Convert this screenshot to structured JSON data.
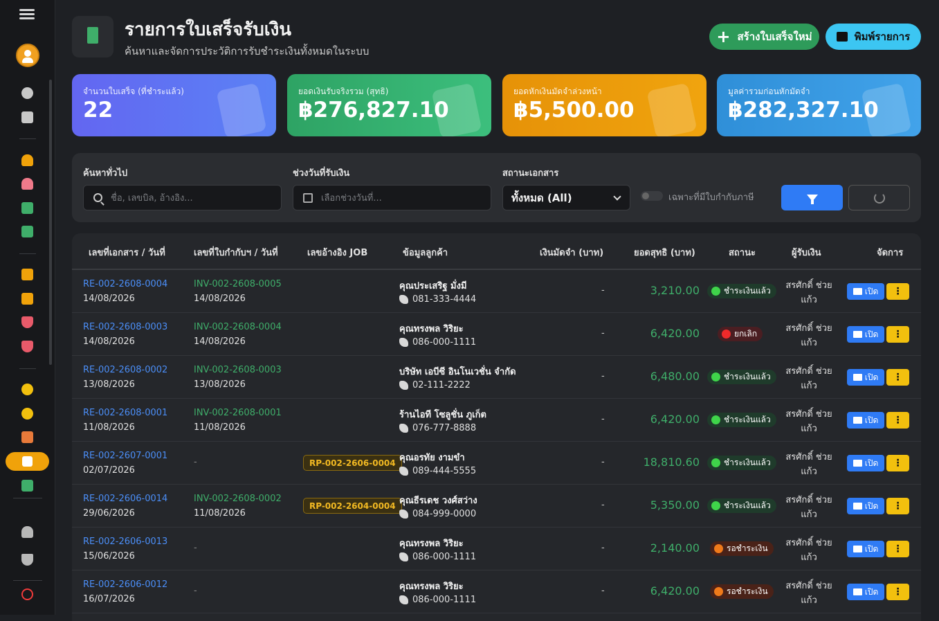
{
  "header": {
    "title": "รายการใบเสร็จรับเงิน",
    "subtitle": "ค้นหาและจัดการประวัติการรับชำระเงินทั้งหมดในระบบ",
    "new_button": "สร้างใบเสร็จใหม่",
    "print_button": "พิมพ์รายการ",
    "new_icon": "+"
  },
  "cards": [
    {
      "label": "จำนวนใบเสร็จ (ที่ชำระแล้ว)",
      "value": "22"
    },
    {
      "label": "ยอดเงินรับจริงรวม (สุทธิ)",
      "value": "฿276,827.10"
    },
    {
      "label": "ยอดหักเงินมัดจำล่วงหน้า",
      "value": "฿5,500.00"
    },
    {
      "label": "มูลค่ารวมก่อนหักมัดจำ",
      "value": "฿282,327.10"
    }
  ],
  "filters": {
    "search_label": "ค้นหาทั่วไป",
    "search_placeholder": "ชื่อ, เลขบิล, อ้างอิง...",
    "date_label": "ช่วงวันที่รับเงิน",
    "date_placeholder": "เลือกช่วงวันที่...",
    "status_label": "สถานะเอกสาร",
    "status_value": "ทั้งหมด (All)",
    "tax_toggle_label": "เฉพาะที่มีใบกำกับภาษี"
  },
  "table": {
    "headers": [
      "เลขที่เอกสาร / วันที่",
      "เลขที่ใบกำกับฯ / วันที่",
      "เลขอ้างอิง JOB",
      "ข้อมูลลูกค้า",
      "เงินมัดจำ (บาท)",
      "ยอดสุทธิ (บาท)",
      "สถานะ",
      "ผู้รับเงิน",
      "จัดการ"
    ],
    "open_label": "เปิด",
    "more_label": "⋮",
    "rows": [
      {
        "doc": "RE-002-2608-0004",
        "date": "14/08/2026",
        "inv": "INV-002-2608-0005",
        "inv_date": "14/08/2026",
        "job": "",
        "customer": "คุณประเสริฐ มั่งมี",
        "phone": "081-333-4444",
        "deposit": "-",
        "net": "3,210.00",
        "status": "ชำระเงินแล้ว",
        "status_type": "paid",
        "receiver": "สรศักดิ์ ช่วยแก้ว"
      },
      {
        "doc": "RE-002-2608-0003",
        "date": "14/08/2026",
        "inv": "INV-002-2608-0004",
        "inv_date": "14/08/2026",
        "job": "",
        "customer": "คุณทรงพล วิริยะ",
        "phone": "086-000-1111",
        "deposit": "-",
        "net": "6,420.00",
        "status": "ยกเลิก",
        "status_type": "cancel",
        "receiver": "สรศักดิ์ ช่วยแก้ว"
      },
      {
        "doc": "RE-002-2608-0002",
        "date": "13/08/2026",
        "inv": "INV-002-2608-0003",
        "inv_date": "13/08/2026",
        "job": "",
        "customer": "บริษัท เอบีซี อินโนเวชั่น จำกัด",
        "phone": "02-111-2222",
        "deposit": "-",
        "net": "6,480.00",
        "status": "ชำระเงินแล้ว",
        "status_type": "paid",
        "receiver": "สรศักดิ์ ช่วยแก้ว"
      },
      {
        "doc": "RE-002-2608-0001",
        "date": "11/08/2026",
        "inv": "INV-002-2608-0001",
        "inv_date": "11/08/2026",
        "job": "",
        "customer": "ร้านไอที โซลูชั่น ภูเก็ต",
        "phone": "076-777-8888",
        "deposit": "-",
        "net": "6,420.00",
        "status": "ชำระเงินแล้ว",
        "status_type": "paid",
        "receiver": "สรศักดิ์ ช่วยแก้ว"
      },
      {
        "doc": "RE-002-2607-0001",
        "date": "02/07/2026",
        "inv": "-",
        "inv_date": "",
        "job": "RP-002-2606-0004",
        "customer": "คุณอรทัย งามขำ",
        "phone": "089-444-5555",
        "deposit": "-",
        "net": "18,810.60",
        "status": "ชำระเงินแล้ว",
        "status_type": "paid",
        "receiver": "สรศักดิ์ ช่วยแก้ว"
      },
      {
        "doc": "RE-002-2606-0014",
        "date": "29/06/2026",
        "inv": "INV-002-2608-0002",
        "inv_date": "11/08/2026",
        "job": "RP-002-2604-0004",
        "customer": "คุณธีรเดช วงศ์สว่าง",
        "phone": "084-999-0000",
        "deposit": "-",
        "net": "5,350.00",
        "status": "ชำระเงินแล้ว",
        "status_type": "paid",
        "receiver": "สรศักดิ์ ช่วยแก้ว"
      },
      {
        "doc": "RE-002-2606-0013",
        "date": "15/06/2026",
        "inv": "-",
        "inv_date": "",
        "job": "",
        "customer": "คุณทรงพล วิริยะ",
        "phone": "086-000-1111",
        "deposit": "-",
        "net": "2,140.00",
        "status": "รอชำระเงิน",
        "status_type": "wait",
        "receiver": "สรศักดิ์ ช่วยแก้ว"
      },
      {
        "doc": "RE-002-2606-0012",
        "date": "16/07/2026",
        "inv": "-",
        "inv_date": "",
        "job": "",
        "customer": "คุณทรงพล วิริยะ",
        "phone": "086-000-1111",
        "deposit": "-",
        "net": "6,420.00",
        "status": "รอชำระเงิน",
        "status_type": "wait",
        "receiver": "สรศักดิ์ ช่วยแก้ว"
      }
    ]
  },
  "colors": {
    "accent": "#f0a20a",
    "paid": "#3fd44a",
    "cancel": "#f02a2a",
    "wait": "#f07a1a",
    "link": "#4b8ef7",
    "net": "#3fae6a"
  }
}
